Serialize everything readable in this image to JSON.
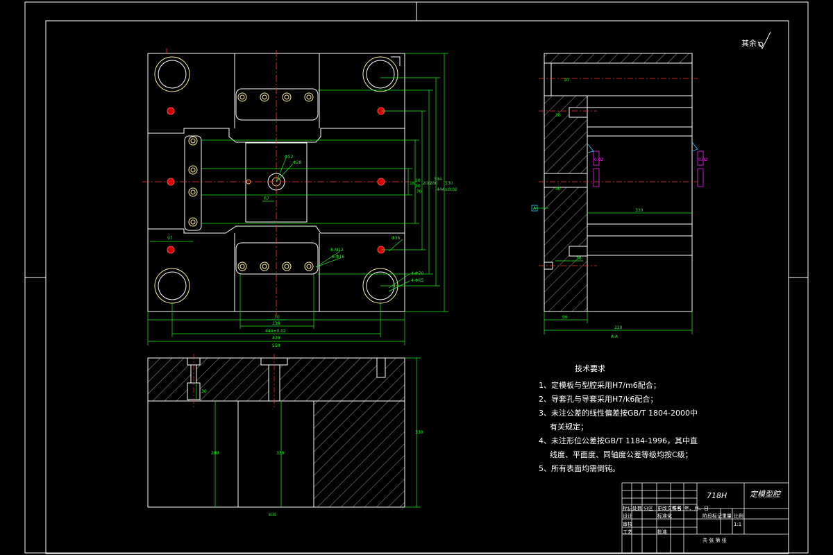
{
  "roughness_note": "其余",
  "material": "718H",
  "part_name": "定模型腔",
  "technical_requirements": {
    "title": "技术要求",
    "items": [
      {
        "text": "1、定模板与型腔采用H7/m6配合；",
        "cont": ""
      },
      {
        "text": "2、导套孔与导套采用H7/k6配合；",
        "cont": ""
      },
      {
        "text": "3、未注公差的线性偏差按GB/T 1804-2000中",
        "cont": "有关规定；"
      },
      {
        "text": "4、未注形位公差按GB/T 1184-1996，其中直",
        "cont": "线度、平面度、同轴度公差等级均按C级；"
      },
      {
        "text": "5、所有表面均需倒钝。",
        "cont": ""
      }
    ]
  },
  "title_block": {
    "row1": [
      "标记",
      "处数",
      "分区",
      "更改文件号",
      "签名",
      "年、月、日"
    ],
    "designer": "设计",
    "standardization": "标准化",
    "stage": "阶段标记",
    "weight": "重量",
    "scale": "比例",
    "scale_value": "1:1",
    "reviewer": "审核",
    "process": "工艺",
    "approve": "批准",
    "sheet": "共  张  第  张"
  },
  "dimensions": {
    "top_view": [
      "97",
      "136",
      "30",
      "R7",
      "444±0.02",
      "420",
      "550",
      "Φ52",
      "Φ28",
      "16",
      "10",
      "30",
      "70",
      "200",
      "280",
      "384",
      "444±0.02",
      "530",
      "8-M12",
      "6-Φ16",
      "Φ36",
      "4-Φ70",
      "4-Φ65"
    ],
    "side_view": [
      "10",
      "330",
      "96",
      "36",
      "220",
      "40",
      "30"
    ],
    "section_view": [
      "30",
      "280",
      "330",
      "330"
    ],
    "section_labels": [
      "A-A",
      "B-B"
    ],
    "datum": "A",
    "tolerance_frames": [
      "0.02",
      "0.02"
    ]
  }
}
